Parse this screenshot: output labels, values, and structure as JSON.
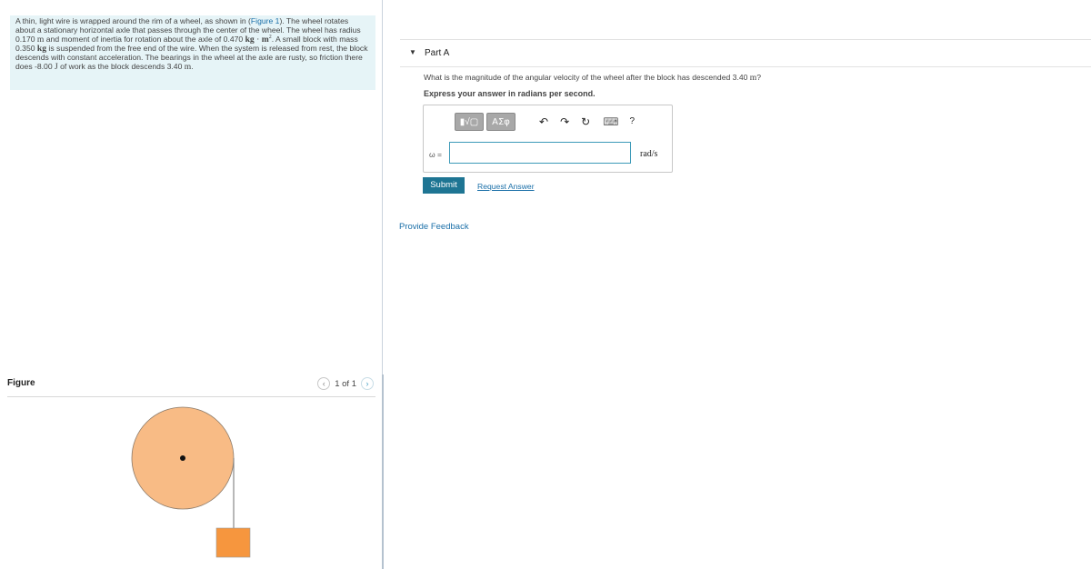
{
  "problem": {
    "s1": "A thin, light wire is wrapped around the rim of a wheel, as shown in (",
    "figure_link": "Figure 1",
    "s2": "). The wheel rotates about a stationary horizontal axle that passes through the center of the wheel. The wheel has radius 0.170 ",
    "unit_m": "m",
    "s3": " and moment of inertia for rotation about the axle of 0.470 ",
    "unit_kg": "kg",
    "dot": " · ",
    "unit_m2": "m",
    "sup2": "2",
    "s4": ". A small block with mass 0.350 ",
    "unit_kg2": "kg",
    "s5": " is suspended from the free end of the wire. When the system is released from rest, the block descends with constant acceleration. The bearings in the wheel at the axle are rusty, so friction there does -8.00 ",
    "unit_J": "J",
    "s6": " of work as the block descends 3.40 ",
    "unit_m3": "m",
    "s7": "."
  },
  "figure": {
    "title": "Figure",
    "pager_text": "1 of 1",
    "prev_glyph": "‹",
    "next_glyph": "›",
    "colors": {
      "wheel": "#f8bb85",
      "wheel_stroke": "#8a7a6a",
      "block": "#f6963e",
      "wire": "#888888",
      "axle": "#111111"
    }
  },
  "part_a": {
    "arrow": "▼",
    "title": "Part A",
    "question_pre": "What is the magnitude of the angular velocity of the wheel after the block has descended 3.40 ",
    "question_unit": "m",
    "question_post": "?",
    "instruction": "Express your answer in radians per second.",
    "toolbar": {
      "templates_label": "▮√▢",
      "greek_label": "ΑΣφ",
      "undo_glyph": "↶",
      "redo_glyph": "↷",
      "reset_glyph": "↻",
      "keyboard_glyph": "⌨",
      "help_glyph": "?"
    },
    "answer_label": "ω =",
    "answer_value": "",
    "unit": "rad/s",
    "submit_label": "Submit",
    "request_label": "Request Answer"
  },
  "feedback_label": "Provide Feedback"
}
